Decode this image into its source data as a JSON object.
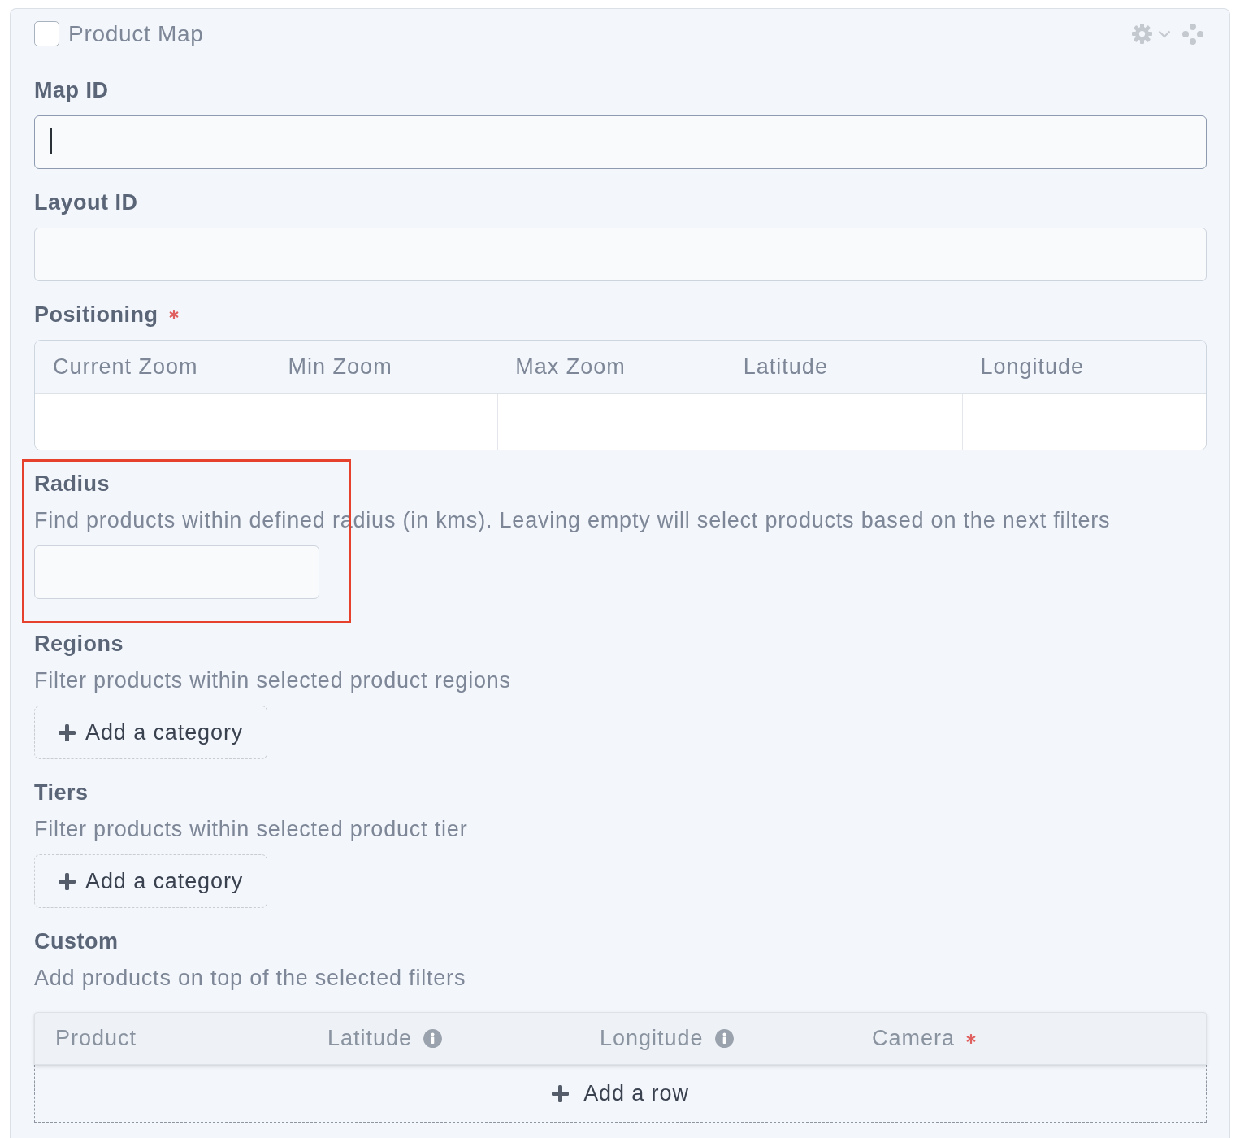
{
  "panel": {
    "title": "Product Map",
    "checked": false
  },
  "sections": [
    {
      "kind": "input",
      "label": "Map ID",
      "required": false,
      "focused": true,
      "wide": true,
      "highlighted": false
    },
    {
      "kind": "input",
      "label": "Layout ID",
      "required": false,
      "focused": false,
      "wide": true,
      "highlighted": false
    },
    {
      "kind": "grid",
      "label": "Positioning",
      "required": true,
      "highlighted": false,
      "columns": [
        "Current Zoom",
        "Min Zoom",
        "Max Zoom",
        "Latitude",
        "Longitude"
      ]
    },
    {
      "kind": "input",
      "label": "Radius",
      "description": "Find products within defined radius (in kms). Leaving empty will select products based on the next filters",
      "required": false,
      "focused": false,
      "wide": false,
      "highlighted": true
    },
    {
      "kind": "category",
      "label": "Regions",
      "description": "Filter products within selected product regions",
      "required": false,
      "highlighted": false,
      "button": "Add a category"
    },
    {
      "kind": "category",
      "label": "Tiers",
      "description": "Filter products within selected product tier",
      "required": false,
      "highlighted": false,
      "button": "Add a category"
    },
    {
      "kind": "rows",
      "label": "Custom",
      "description": "Add products on top of the selected filters",
      "required": false,
      "highlighted": false,
      "columns": [
        {
          "label": "Product",
          "info": false,
          "required": false
        },
        {
          "label": "Latitude",
          "info": true,
          "required": false
        },
        {
          "label": "Longitude",
          "info": true,
          "required": false
        },
        {
          "label": "Camera",
          "info": false,
          "required": true
        }
      ],
      "button": "Add a row"
    }
  ]
}
